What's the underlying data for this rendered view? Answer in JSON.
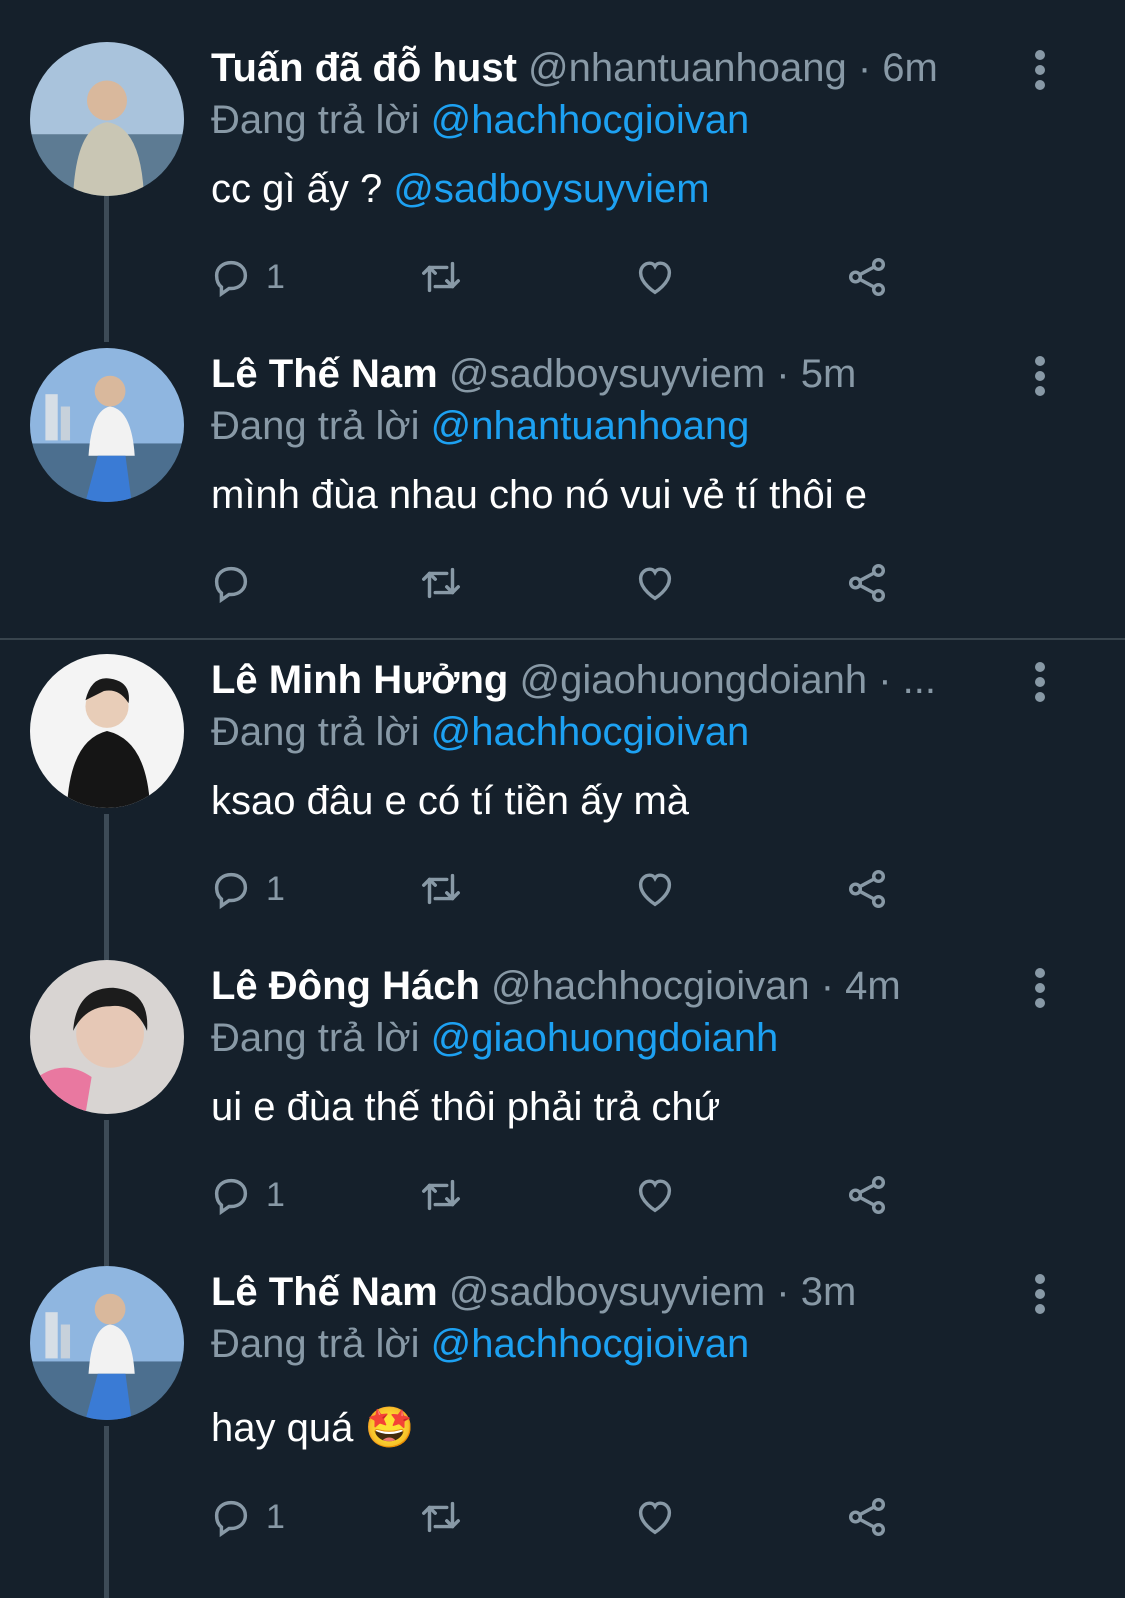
{
  "replying_prefix": "Đang trả lời",
  "tweets": [
    {
      "name": "Tuấn đã đỗ hust",
      "handle": "@nhantuanhoang",
      "time": "· 6m",
      "reply_to": "@hachhocgioivan",
      "text": "cc gì ấy ?",
      "text_mention": "@sadboysuyviem",
      "reply_count": "1"
    },
    {
      "name": "Lê Thế Nam",
      "handle": "@sadboysuyviem",
      "time": "· 5m",
      "reply_to": "@nhantuanhoang",
      "text": "mình đùa nhau cho nó vui vẻ tí thôi e",
      "text_mention": "",
      "reply_count": ""
    },
    {
      "name": "Lê Minh Hưởng",
      "handle": "@giaohuongdoianh",
      "time": "· ...",
      "reply_to": "@hachhocgioivan",
      "text": "ksao đâu e có tí tiền ấy mà",
      "text_mention": "",
      "reply_count": "1"
    },
    {
      "name": "Lê Đông Hách",
      "handle": "@hachhocgioivan",
      "time": "· 4m",
      "reply_to": "@giaohuongdoianh",
      "text": "ui e đùa thế thôi phải trả chứ",
      "text_mention": "",
      "reply_count": "1"
    },
    {
      "name": "Lê Thế Nam",
      "handle": "@sadboysuyviem",
      "time": "· 3m",
      "reply_to": "@hachhocgioivan",
      "text": "hay quá 🤩",
      "text_mention": "",
      "reply_count": "1"
    }
  ],
  "colors": {
    "background": "#15202b",
    "secondary_text": "#8899a6",
    "accent": "#1da1f2",
    "thread_line": "#3d4b57"
  },
  "icons": [
    "reply-icon",
    "retweet-icon",
    "like-icon",
    "share-icon",
    "more-icon"
  ]
}
